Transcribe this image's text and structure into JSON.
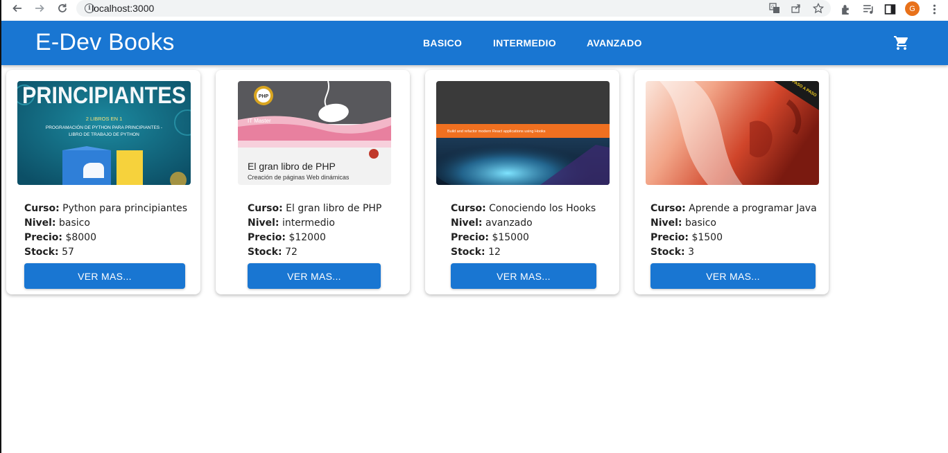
{
  "browser": {
    "url": "localhost:3000",
    "profile_initial": "G"
  },
  "appbar": {
    "title": "E-Dev Books",
    "menu": [
      "BASICO",
      "INTERMEDIO",
      "AVANZADO"
    ],
    "color": "#1976d2"
  },
  "labels": {
    "curso": "Curso:",
    "nivel": "Nivel:",
    "precio": "Precio:",
    "stock": "Stock:"
  },
  "books": [
    {
      "curso": "Python para principiantes",
      "nivel": "basico",
      "precio": "$8000",
      "stock": "57",
      "button": "VER MAS...",
      "cover_text": {
        "headline": "PRINCIPIANTES",
        "line1": "2 LIBROS EN 1",
        "line2": "PROGRAMACIÓN DE PYTHON PARA PRINCIPIANTES -",
        "line3": "LIBRO DE TRABAJO DE PYTHON"
      }
    },
    {
      "curso": "El gran libro de PHP",
      "nivel": "intermedio",
      "precio": "$12000",
      "stock": "72",
      "button": "VER MAS...",
      "cover_text": {
        "badge": "PHP",
        "publisher": "IT Master",
        "title": "El gran libro de PHP",
        "subtitle": "Creación de páginas Web dinámicas"
      }
    },
    {
      "curso": "Conociendo los Hooks",
      "nivel": "avanzado",
      "precio": "$15000",
      "stock": "12",
      "button": "VER MAS...",
      "cover_text": {
        "tagline": "Build and refactor modern React applications using Hooks"
      }
    },
    {
      "curso": "Aprende a programar Java",
      "nivel": "basico",
      "precio": "$1500",
      "stock": "3",
      "button": "VER MAS...",
      "cover_text": {
        "corner": "PASO A PASO"
      }
    }
  ]
}
